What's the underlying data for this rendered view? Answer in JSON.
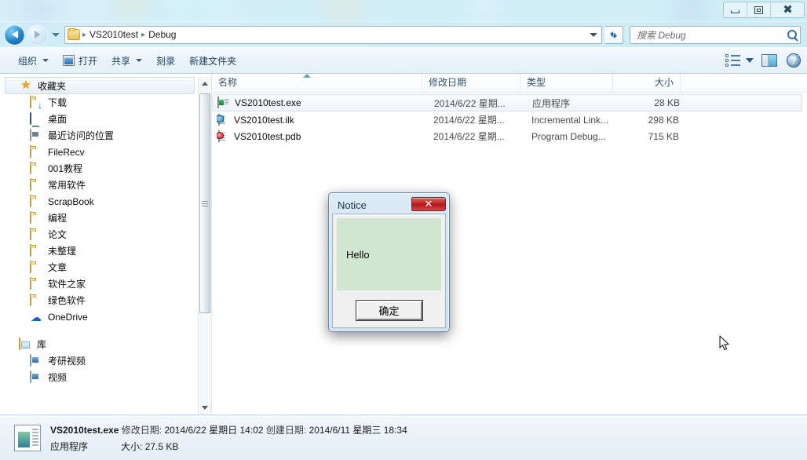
{
  "window": {
    "controls": {
      "minimize": "minimize-button",
      "maximize": "maximize-button",
      "close": "close-button"
    }
  },
  "navbar": {
    "back": "back-button",
    "forward": "forward-button",
    "history_dropdown": "recent-pages-dropdown",
    "breadcrumb": [
      "VS2010test",
      "Debug"
    ],
    "separator": "▸",
    "refresh": "refresh-button"
  },
  "search": {
    "placeholder": "搜索 Debug"
  },
  "toolbar": {
    "organize": "组织",
    "open": "打开",
    "share": "共享",
    "burn": "刻录",
    "new_folder": "新建文件夹",
    "help": "?"
  },
  "sidebar": {
    "favorites": {
      "label": "收藏夹",
      "icon": "star-icon"
    },
    "items": [
      {
        "label": "下载",
        "icon": "download-folder-icon"
      },
      {
        "label": "桌面",
        "icon": "desktop-icon"
      },
      {
        "label": "最近访问的位置",
        "icon": "recent-places-icon"
      },
      {
        "label": "FileRecv",
        "icon": "folder-icon"
      },
      {
        "label": "001教程",
        "icon": "folder-icon"
      },
      {
        "label": "常用软件",
        "icon": "folder-icon"
      },
      {
        "label": "ScrapBook",
        "icon": "folder-icon"
      },
      {
        "label": "编程",
        "icon": "folder-icon"
      },
      {
        "label": "论文",
        "icon": "folder-icon"
      },
      {
        "label": "未整理",
        "icon": "folder-icon"
      },
      {
        "label": "文章",
        "icon": "folder-icon"
      },
      {
        "label": "软件之家",
        "icon": "folder-icon"
      },
      {
        "label": "绿色软件",
        "icon": "folder-icon"
      },
      {
        "label": "OneDrive",
        "icon": "onedrive-cloud-icon"
      }
    ],
    "libraries": {
      "label": "库",
      "icon": "library-icon"
    },
    "library_items": [
      {
        "label": "考研视频",
        "icon": "video-library-icon"
      },
      {
        "label": "视频",
        "icon": "video-library-icon"
      }
    ]
  },
  "columns": [
    {
      "key": "name",
      "label": "名称"
    },
    {
      "key": "date",
      "label": "修改日期"
    },
    {
      "key": "type",
      "label": "类型"
    },
    {
      "key": "size",
      "label": "大小"
    }
  ],
  "sort": {
    "column": "名称",
    "direction": "ascending"
  },
  "files": [
    {
      "name": "VS2010test.exe",
      "date": "2014/6/22 星期...",
      "type": "应用程序",
      "size": "28 KB",
      "icon": "exe-icon",
      "selected": true
    },
    {
      "name": "VS2010test.ilk",
      "date": "2014/6/22 星期...",
      "type": "Incremental Link...",
      "size": "298 KB",
      "icon": "ilk-file-icon",
      "selected": false
    },
    {
      "name": "VS2010test.pdb",
      "date": "2014/6/22 星期...",
      "type": "Program Debug...",
      "size": "715 KB",
      "icon": "pdb-file-icon",
      "selected": false
    }
  ],
  "statusbar": {
    "filename": "VS2010test.exe",
    "modified_label": "修改日期:",
    "modified_value": "2014/6/22 星期日 14:02",
    "created_label": "创建日期:",
    "created_value": "2014/6/11 星期三 18:34",
    "type": "应用程序",
    "size_label": "大小:",
    "size_value": "27.5 KB"
  },
  "dialog": {
    "title": "Notice",
    "message": "Hello",
    "ok_button": "确定",
    "close_glyph": "✕",
    "content_bg": "#cfe7cf"
  },
  "colors": {
    "accent": "#2f6fae",
    "glass": "#e2f6fd",
    "close_red": "#b01a1a",
    "folder_yellow": "#e8c463"
  }
}
